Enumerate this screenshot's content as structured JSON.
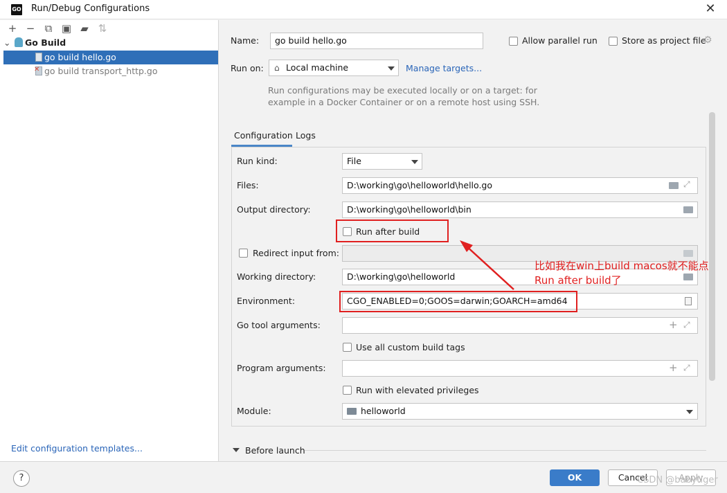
{
  "window": {
    "title": "Run/Debug Configurations",
    "logo_text": "GO"
  },
  "left_panel": {
    "tree": {
      "group": "Go Build",
      "items": [
        "go build hello.go",
        "go build transport_http.go"
      ]
    },
    "edit_templates": "Edit configuration templates..."
  },
  "form": {
    "name_label": "Name:",
    "name_value": "go build hello.go",
    "allow_parallel": "Allow parallel run",
    "store_project": "Store as project file",
    "run_on_label": "Run on:",
    "run_on_value": "Local machine",
    "manage_targets": "Manage targets...",
    "hint_line1": "Run configurations may be executed locally or on a target: for",
    "hint_line2": "example in a Docker Container or on a remote host using SSH.",
    "tabs": [
      "Configuration",
      "Logs"
    ],
    "run_kind_label": "Run kind:",
    "run_kind_value": "File",
    "files_label": "Files:",
    "files_value": "D:\\working\\go\\helloworld\\hello.go",
    "output_dir_label": "Output directory:",
    "output_dir_value": "D:\\working\\go\\helloworld\\bin",
    "run_after_build": "Run after build",
    "redirect_input": "Redirect input from:",
    "working_dir_label": "Working directory:",
    "working_dir_value": "D:\\working\\go\\helloworld",
    "environment_label": "Environment:",
    "environment_value": "CGO_ENABLED=0;GOOS=darwin;GOARCH=amd64",
    "go_tool_args_label": "Go tool arguments:",
    "use_custom_tags": "Use all custom build tags",
    "program_args_label": "Program arguments:",
    "run_elevated": "Run with elevated privileges",
    "module_label": "Module:",
    "module_value": "helloworld",
    "before_launch": "Before launch"
  },
  "annotation": {
    "line1": "比如我在win上build macos就不能点",
    "line2": "Run after build了"
  },
  "buttons": {
    "help": "?",
    "ok": "OK",
    "cancel": "Cancel",
    "apply": "Apply"
  },
  "watermark": "CSDN @babytiger",
  "colors": {
    "accent": "#2f6fb8",
    "annotation": "#e02020",
    "link": "#2a65b8"
  }
}
